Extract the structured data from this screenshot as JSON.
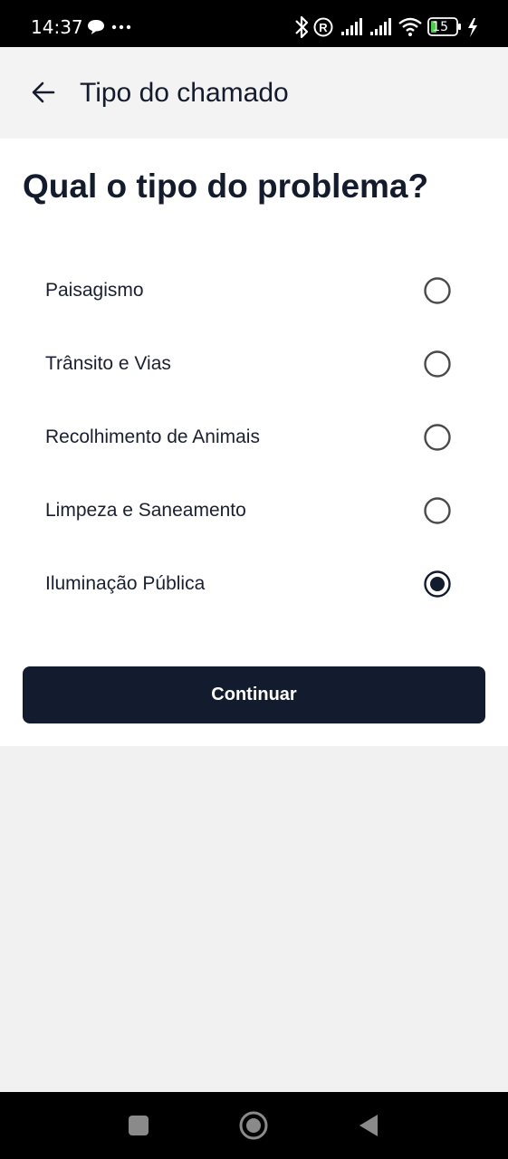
{
  "status_bar": {
    "time": "14:37",
    "battery": "15",
    "icons": [
      "message-icon",
      "more-dots-icon",
      "bluetooth-icon",
      "registered-icon",
      "signal-icon",
      "signal-icon",
      "wifi-icon",
      "battery-icon",
      "charging-icon"
    ]
  },
  "header": {
    "title": "Tipo do chamado",
    "back_icon": "arrow-left-icon"
  },
  "main": {
    "question": "Qual o tipo do problema?",
    "options": [
      {
        "label": "Paisagismo",
        "selected": false
      },
      {
        "label": "Trânsito e Vias",
        "selected": false
      },
      {
        "label": "Recolhimento de Animais",
        "selected": false
      },
      {
        "label": "Limpeza e Saneamento",
        "selected": false
      },
      {
        "label": "Iluminação Pública",
        "selected": true
      }
    ],
    "continue_label": "Continuar"
  },
  "nav_bar": {
    "icons": [
      "recent-apps-icon",
      "home-icon",
      "back-icon"
    ]
  },
  "colors": {
    "primary": "#131b2e",
    "background": "#f1f1f1",
    "surface": "#ffffff",
    "radio_border": "#4a4a4a"
  }
}
